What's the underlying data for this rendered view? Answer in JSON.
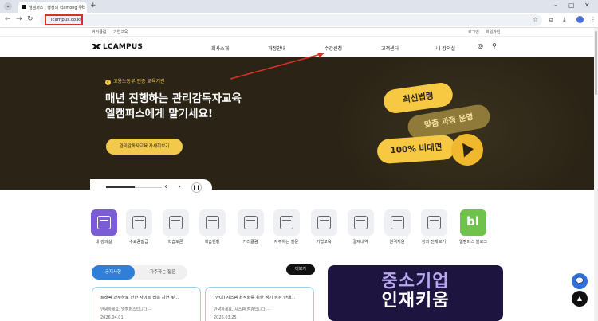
{
  "browser": {
    "tab_title": "엘캠퍼스 | 행정의 혁among 우리",
    "url": "lcampus.co.kr"
  },
  "util": {
    "left": [
      "커리큘럼",
      "기업교육"
    ],
    "right": [
      "로그인",
      "회원가입"
    ]
  },
  "header": {
    "logo": "LCAMPUS",
    "menu": [
      "회사소개",
      "과정안내",
      "수강신청",
      "고객센터",
      "내 강의실"
    ]
  },
  "hero": {
    "badge": "고용노동부 인증 교육기관",
    "headline_1": "매년 진행하는 관리감독자교육",
    "headline_2": "엘캠퍼스에게 맡기세요!",
    "cta": "관리감독자교육 자세히보기",
    "pill_1": "최신법령",
    "pill_2": "맞춤 과정 운영",
    "pill_3": "100% 비대면"
  },
  "quick_menu": [
    "내 강의실",
    "수료증발급",
    "학습토론",
    "학습현황",
    "커리큘럼",
    "자주하는 질문",
    "기업교육",
    "결제내역",
    "원격지원",
    "강의 전체보기",
    "엘캠퍼스 블로그"
  ],
  "board": {
    "tab_notice": "공지사항",
    "tab_faq": "자주하는 질문",
    "more": "더보기",
    "cards": [
      {
        "title": "트래픽 과부하로 인한 사이트 접속 지연 및...",
        "summary": "안녕하세요, 엘캠퍼스입니다.···",
        "date": "2026.04.01"
      },
      {
        "title": "[안내] 시스템 최적화를 위한 정기 점검 안내...",
        "summary": "안녕하세요, 시스템 점검입니다.···",
        "date": "2026.03.25"
      }
    ]
  },
  "banner": {
    "line_1": "중소기업",
    "line_2": "인재키움"
  },
  "colors": {
    "hero_bg": "#2b2416",
    "accent_yellow": "#f7c842",
    "primary_blue": "#2f7fd8",
    "highlight_red": "#d93025"
  }
}
